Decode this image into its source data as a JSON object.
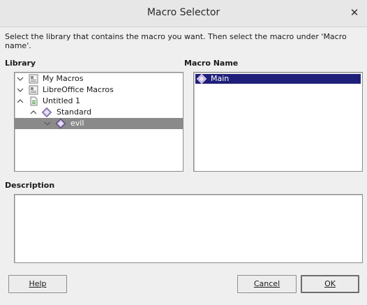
{
  "window": {
    "title": "Macro Selector"
  },
  "instructions": "Select the library that contains the macro you want. Then select the macro under 'Macro name'.",
  "library": {
    "label": "Library",
    "items": [
      {
        "label": "My Macros",
        "icon": "library-icon",
        "expanded": false,
        "level": 0
      },
      {
        "label": "LibreOffice Macros",
        "icon": "library-icon",
        "expanded": false,
        "level": 0
      },
      {
        "label": "Untitled 1",
        "icon": "document-icon",
        "expanded": true,
        "level": 0
      },
      {
        "label": "Standard",
        "icon": "basic-library-icon",
        "expanded": true,
        "level": 1
      },
      {
        "label": "evil",
        "icon": "module-icon",
        "expanded": true,
        "level": 2,
        "selected": true
      }
    ]
  },
  "macro_name": {
    "label": "Macro Name",
    "items": [
      {
        "label": "Main",
        "icon": "macro-icon",
        "selected": true
      }
    ]
  },
  "description": {
    "label": "Description",
    "value": ""
  },
  "buttons": {
    "help": "Help",
    "cancel": "Cancel",
    "ok": "OK"
  },
  "colors": {
    "selection": "#1f1f7a",
    "tree_selection": "#8a8a8a"
  }
}
